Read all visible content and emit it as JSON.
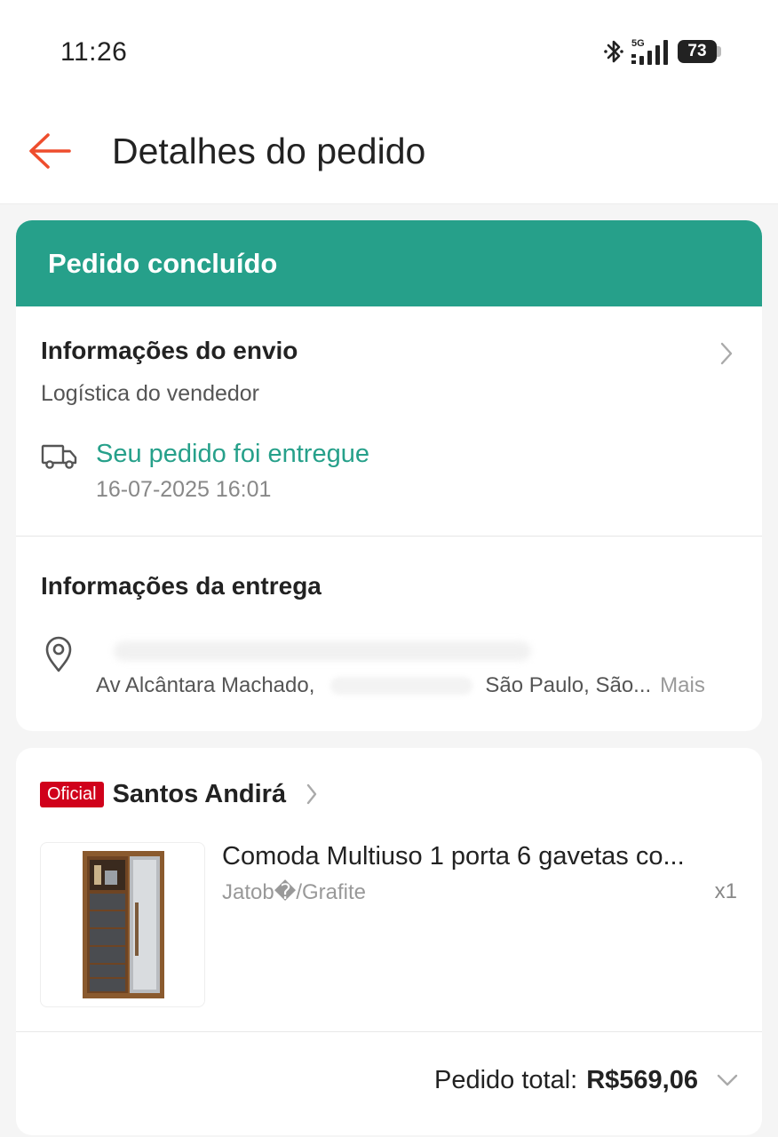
{
  "status_bar": {
    "time": "11:26",
    "network": "5G",
    "battery": "73"
  },
  "header": {
    "title": "Detalhes do pedido",
    "accent_color": "#ee4d2d"
  },
  "order": {
    "status_banner": "Pedido concluído",
    "status_color": "#26a08a",
    "shipping": {
      "title": "Informações do envio",
      "carrier": "Logística do vendedor",
      "tracking_status": "Seu pedido foi entregue",
      "tracking_time": "16-07-2025 16:01"
    },
    "delivery": {
      "title": "Informações da entrega",
      "street": "Av Alcântara Machado,",
      "city": "São Paulo, São...",
      "more_label": "Mais"
    }
  },
  "shop": {
    "badge": "Oficial",
    "badge_color": "#d0011b",
    "name": "Santos Andirá"
  },
  "product": {
    "name": "Comoda Multiuso 1 porta 6 gavetas co...",
    "variant": "Jatob�/Grafite",
    "quantity": "x1"
  },
  "total": {
    "label": "Pedido total:",
    "value": "R$569,06"
  }
}
